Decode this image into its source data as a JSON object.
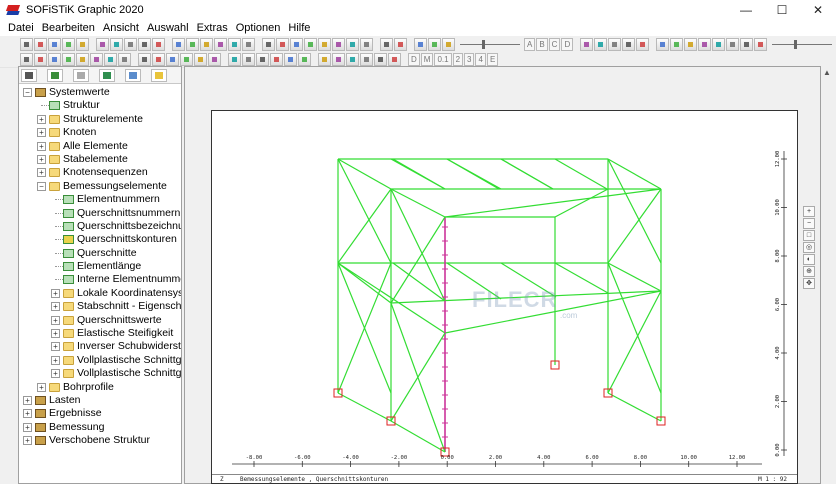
{
  "window": {
    "title": "SOFiSTiK Graphic 2020",
    "buttons": {
      "minimize": "—",
      "maximize": "☐",
      "close": "✕"
    }
  },
  "menu": [
    "Datei",
    "Bearbeiten",
    "Ansicht",
    "Auswahl",
    "Extras",
    "Optionen",
    "Hilfe"
  ],
  "toolbar2_labels": [
    "D",
    "M",
    "0.1",
    "2",
    "3",
    "4",
    "E"
  ],
  "toolbar1_labels": [
    "A",
    "B",
    "C",
    "D"
  ],
  "tree": [
    {
      "label": "Systemwerte",
      "level": 0,
      "icon": "special",
      "expander": "−"
    },
    {
      "label": "Struktur",
      "level": 1,
      "icon": "sheet",
      "expander": ""
    },
    {
      "label": "Strukturelemente",
      "level": 1,
      "icon": "folder",
      "expander": "+"
    },
    {
      "label": "Knoten",
      "level": 1,
      "icon": "folder",
      "expander": "+"
    },
    {
      "label": "Alle Elemente",
      "level": 1,
      "icon": "folder",
      "expander": "+"
    },
    {
      "label": "Stabelemente",
      "level": 1,
      "icon": "folder",
      "expander": "+"
    },
    {
      "label": "Knotensequenzen",
      "level": 1,
      "icon": "folder",
      "expander": "+"
    },
    {
      "label": "Bemessungselemente",
      "level": 1,
      "icon": "folder",
      "expander": "−"
    },
    {
      "label": "Elementnummern",
      "level": 2,
      "icon": "sheet",
      "expander": ""
    },
    {
      "label": "Querschnittsnummern",
      "level": 2,
      "icon": "sheet",
      "expander": ""
    },
    {
      "label": "Querschnittsbezeichnungen",
      "level": 2,
      "icon": "sheet",
      "expander": ""
    },
    {
      "label": "Querschnittskonturen",
      "level": 2,
      "icon": "sheetyellow",
      "expander": ""
    },
    {
      "label": "Querschnitte",
      "level": 2,
      "icon": "sheet",
      "expander": ""
    },
    {
      "label": "Elementlänge",
      "level": 2,
      "icon": "sheet",
      "expander": ""
    },
    {
      "label": "Interne Elementnummern",
      "level": 2,
      "icon": "sheet",
      "expander": ""
    },
    {
      "label": "Lokale Koordinatensysteme",
      "level": 2,
      "icon": "folder",
      "expander": "+"
    },
    {
      "label": "Stabschnitt - Eigenschaften",
      "level": 2,
      "icon": "folder",
      "expander": "+"
    },
    {
      "label": "Querschnittswerte",
      "level": 2,
      "icon": "folder",
      "expander": "+"
    },
    {
      "label": "Elastische Steifigkeit",
      "level": 2,
      "icon": "folder",
      "expander": "+"
    },
    {
      "label": "Inverser Schubwiderstand",
      "level": 2,
      "icon": "folder",
      "expander": "+"
    },
    {
      "label": "Vollplastische Schnittgröße,",
      "level": 2,
      "icon": "folder",
      "expander": "+"
    },
    {
      "label": "Vollplastische Schnittgröße,",
      "level": 2,
      "icon": "folder",
      "expander": "+"
    },
    {
      "label": "Bohrprofile",
      "level": 1,
      "icon": "folder",
      "expander": "+"
    },
    {
      "label": "Lasten",
      "level": 0,
      "icon": "special",
      "expander": "+"
    },
    {
      "label": "Ergebnisse",
      "level": 0,
      "icon": "special",
      "expander": "+"
    },
    {
      "label": "Bemessung",
      "level": 0,
      "icon": "special",
      "expander": "+"
    },
    {
      "label": "Verschobene Struktur",
      "level": 0,
      "icon": "special",
      "expander": "+"
    }
  ],
  "drawing": {
    "x_ticks": [
      "-8.00",
      "-6.00",
      "-4.00",
      "-2.00",
      "0.00",
      "2.00",
      "4.00",
      "6.00",
      "8.00",
      "10.00",
      "12.00"
    ],
    "y_ticks": [
      "12.00",
      "10.00",
      "8.00",
      "6.00",
      "4.00",
      "2.00",
      "0.00"
    ],
    "status_left": "Z",
    "status_text": "Bemessungselemente , Querschnittskonturen",
    "status_right": "M 1 : 92",
    "frame_color": "#33dd33",
    "highlight_color": "#cc3399",
    "support_color": "#dd2222"
  },
  "watermark": {
    "text": "FILECR",
    "sub": ".com"
  }
}
